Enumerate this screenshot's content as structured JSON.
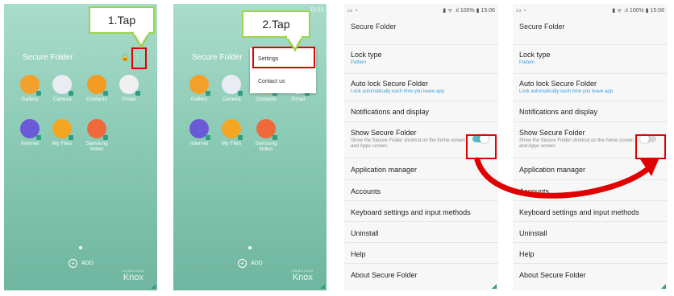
{
  "callouts": {
    "step1": "1.Tap",
    "step2": "2.Tap"
  },
  "home": {
    "title": "Secure Folder",
    "apps": [
      {
        "label": "Gallery",
        "color": "#f3a02b"
      },
      {
        "label": "Camera",
        "color": "#e9ecf3"
      },
      {
        "label": "Contacts",
        "color": "#f39b22"
      },
      {
        "label": "Email",
        "color": "#f0f0f0"
      },
      {
        "label": "Internet",
        "color": "#6b5ad8"
      },
      {
        "label": "My Files",
        "color": "#f4a522"
      },
      {
        "label": "Samsung Notes",
        "color": "#ee6a3b"
      }
    ],
    "add_label": "ADD",
    "knox_small": "SAMSUNG",
    "knox_big": "Knox",
    "status_time": "11:21"
  },
  "menu": {
    "items": [
      "Settings",
      "Contact us"
    ]
  },
  "settings": {
    "status_battery": "100%",
    "status_time": "15:06",
    "title": "Secure Folder",
    "items": {
      "lock_type": {
        "title": "Lock type",
        "sub": "Pattern"
      },
      "auto_lock": {
        "title": "Auto lock Secure Folder",
        "sub": "Lock automatically each time you leave app"
      },
      "notifications": {
        "title": "Notifications and display"
      },
      "show_sf": {
        "title": "Show Secure Folder",
        "desc": "Show the Secure Folder shortcut on the home screen and Apps screen."
      },
      "app_manager": {
        "title": "Application manager"
      },
      "accounts": {
        "title": "Accounts"
      },
      "keyboard": {
        "title": "Keyboard settings and input methods"
      },
      "uninstall": {
        "title": "Uninstall"
      },
      "help": {
        "title": "Help"
      },
      "about": {
        "title": "About Secure Folder"
      }
    },
    "toggle_before": "on",
    "toggle_after": "off"
  },
  "colors": {
    "highlight": "#e00000",
    "callout_border": "#9bd34d",
    "toggle_on": "#5bb9c5",
    "link": "#3a9fd5"
  }
}
